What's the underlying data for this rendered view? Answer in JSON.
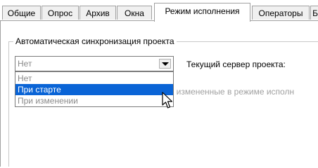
{
  "tabs": [
    {
      "label": "Общие"
    },
    {
      "label": "Опрос"
    },
    {
      "label": "Архив"
    },
    {
      "label": "Окна"
    },
    {
      "label": "Режим исполнения",
      "active": true
    },
    {
      "label": "Операторы"
    },
    {
      "label": "Б"
    }
  ],
  "sync_group": {
    "title": "Автоматическая синхронизация проекта",
    "combo": {
      "value": "Нет",
      "options": [
        "Нет",
        "При старте",
        "При изменении"
      ],
      "highlighted": "При старте"
    },
    "server_label": "Текущий сервер проекта:",
    "hint_fragment": "ки, измененные в режиме исполн"
  },
  "colors": {
    "selection": "#0a64d6",
    "border": "#a0a0a0",
    "disabled_text": "#8a8a8a"
  },
  "icons": {
    "combo_arrow": "chevron-down-icon",
    "cursor": "mouse-pointer-icon"
  }
}
